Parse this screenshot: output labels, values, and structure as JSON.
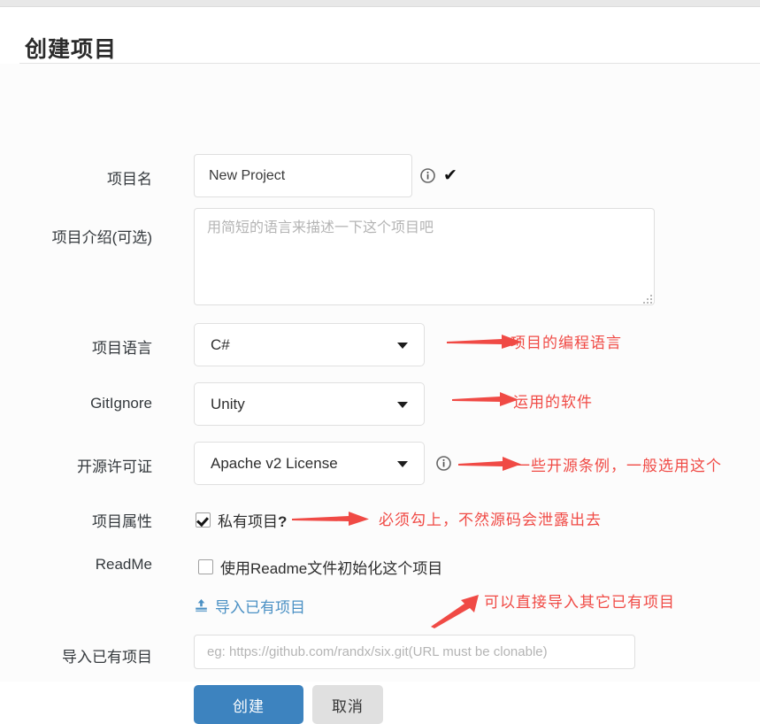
{
  "page": {
    "title": "创建项目"
  },
  "form": {
    "project_name": {
      "label": "项目名",
      "value": "New Project",
      "info_icon": "info-circle-icon",
      "valid_icon": "check-mark-icon"
    },
    "project_desc": {
      "label": "项目介绍(可选)",
      "placeholder": "用简短的语言来描述一下这个项目吧",
      "value": ""
    },
    "language": {
      "label": "项目语言",
      "selected": "C#"
    },
    "gitignore": {
      "label": "GitIgnore",
      "selected": "Unity"
    },
    "license": {
      "label": "开源许可证",
      "selected": "Apache v2 License",
      "info_icon": "info-circle-icon"
    },
    "visibility": {
      "label": "项目属性",
      "checkbox_label": "私有项目",
      "checkbox_suffix": "?",
      "checked": true
    },
    "readme": {
      "label": "ReadMe",
      "checkbox_label": "使用Readme文件初始化这个项目",
      "checked": false
    },
    "import_link": {
      "text": "导入已有项目",
      "icon": "upload-icon"
    },
    "import_url": {
      "label": "导入已有项目",
      "placeholder": "eg: https://github.com/randx/six.git(URL must be clonable)",
      "value": ""
    }
  },
  "buttons": {
    "submit": "创建",
    "cancel": "取消"
  },
  "annotations": [
    {
      "text": "项目的编程语言"
    },
    {
      "text": "运用的软件"
    },
    {
      "text": "一些开源条例，一般选用这个"
    },
    {
      "text": "必须勾上，不然源码会泄露出去"
    },
    {
      "text": "可以直接导入其它已有项目"
    }
  ],
  "colors": {
    "annotation_red": "#f04a45",
    "primary_blue": "#3d83bf",
    "link_blue": "#4a90c4"
  }
}
